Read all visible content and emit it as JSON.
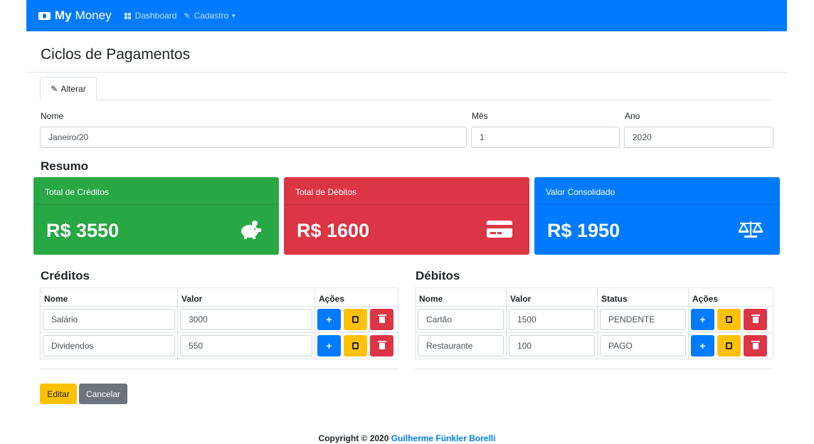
{
  "navbar": {
    "brand_bold": "My",
    "brand_rest": "Money",
    "dashboard": "Dashboard",
    "cadastro": "Cadastro"
  },
  "page": {
    "title": "Ciclos de Pagamentos",
    "tab": "Alterar"
  },
  "form": {
    "nome_label": "Nome",
    "nome_value": "Janeiro/20",
    "mes_label": "Mês",
    "mes_value": "1",
    "ano_label": "Ano",
    "ano_value": "2020"
  },
  "resumo": {
    "title": "Resumo",
    "creditos": {
      "label": "Total de Créditos",
      "value": "R$ 3550",
      "color": "#28a745",
      "icon": "piggy-bank-icon"
    },
    "debitos": {
      "label": "Total de Débitos",
      "value": "R$ 1600",
      "color": "#dc3545",
      "icon": "credit-card-icon"
    },
    "consolidado": {
      "label": "Valor Consolidado",
      "value": "R$ 1950",
      "color": "#007bff",
      "icon": "balance-scale-icon"
    }
  },
  "creditos": {
    "title": "Créditos",
    "headers": [
      "Nome",
      "Valor",
      "Ações"
    ],
    "rows": [
      {
        "nome": "Salário",
        "valor": "3000"
      },
      {
        "nome": "Dividendos",
        "valor": "550"
      }
    ]
  },
  "debitos": {
    "title": "Débitos",
    "headers": [
      "Nome",
      "Valor",
      "Status",
      "Ações"
    ],
    "rows": [
      {
        "nome": "Cartão",
        "valor": "1500",
        "status": "PENDENTE"
      },
      {
        "nome": "Restaurante",
        "valor": "100",
        "status": "PAGO"
      }
    ]
  },
  "actions": {
    "edit": "Editar",
    "cancel": "Cancelar"
  },
  "footer": {
    "text": "Copyright © 2020",
    "author": "Guilherme Fünkler Borelli"
  }
}
